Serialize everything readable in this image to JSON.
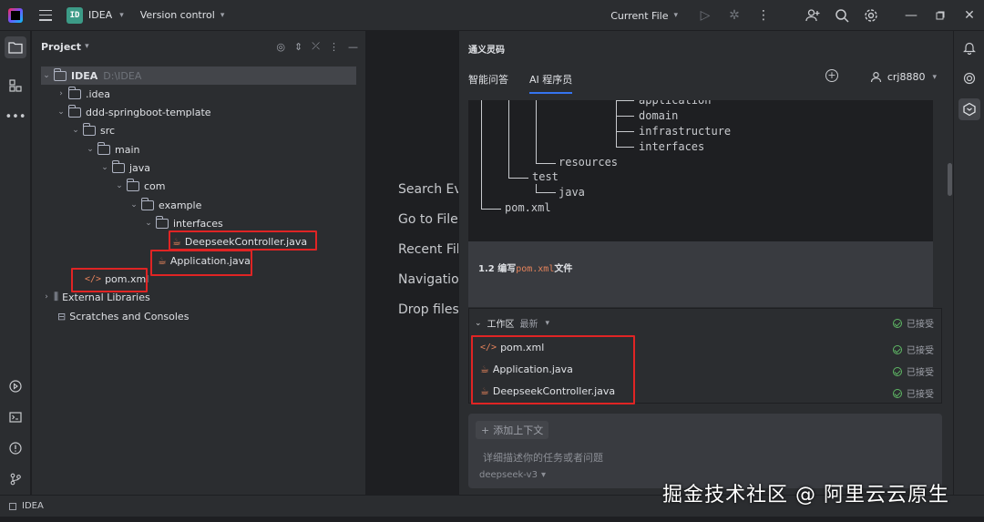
{
  "titlebar": {
    "project_badge": "ID",
    "project_name": "IDEA",
    "vcs": "Version control",
    "current_file": "Current File"
  },
  "project_panel": {
    "title": "Project",
    "tree": [
      {
        "label": "IDEA",
        "path": "D:\\IDEA"
      },
      {
        "label": ".idea"
      },
      {
        "label": "ddd-springboot-template"
      },
      {
        "label": "src"
      },
      {
        "label": "main"
      },
      {
        "label": "java"
      },
      {
        "label": "com"
      },
      {
        "label": "example"
      },
      {
        "label": "interfaces"
      },
      {
        "label": "DeepseekController.java"
      },
      {
        "label": "Application.java"
      },
      {
        "label": "pom.xml"
      },
      {
        "label": "External Libraries"
      },
      {
        "label": "Scratches and Consoles"
      }
    ]
  },
  "editor_hints": [
    "Search Eve",
    "Go to File",
    "Recent Fil",
    "Navigation",
    "Drop files"
  ],
  "ai_panel": {
    "title": "通义灵码",
    "tabs": [
      "智能问答",
      "AI 程序员"
    ],
    "user": "crj8880",
    "code_lines": [
      "application",
      "domain",
      "infrastructure",
      "interfaces",
      "resources",
      "test",
      "java",
      "pom.xml"
    ],
    "section_prefix": "1.2 编写",
    "section_file": "pom.xml",
    "section_suffix": "文件",
    "workspace": {
      "label": "工作区",
      "filter": "最新",
      "status": "已接受",
      "files": [
        {
          "name": "pom.xml",
          "status": "已接受"
        },
        {
          "name": "Application.java",
          "status": "已接受"
        },
        {
          "name": "DeepseekController.java",
          "status": "已接受"
        }
      ]
    },
    "add_context": "添加上下文",
    "input_placeholder": "详细描述你的任务或者问题",
    "model": "deepseek-v3"
  },
  "statusbar": {
    "project": "IDEA"
  },
  "watermark": "掘金技术社区 @ 阿里云云原生",
  "icons": {
    "accent": "#3574f0",
    "accept": "#5fb865",
    "highlight_box": "#e02424"
  }
}
